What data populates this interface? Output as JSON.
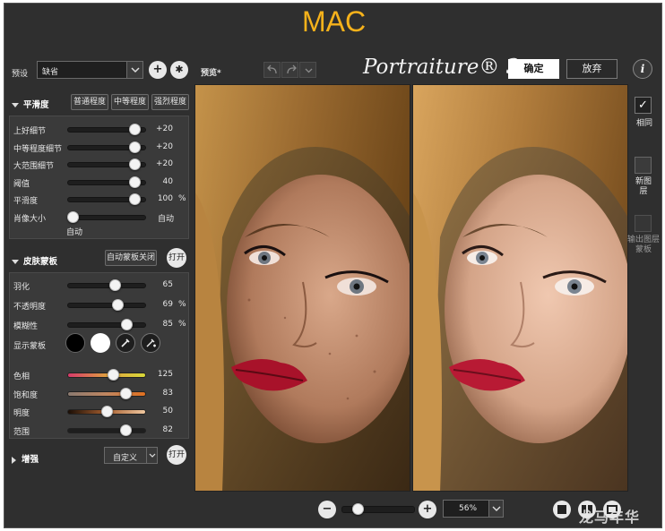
{
  "window": {
    "title": "MAC"
  },
  "toolbar": {
    "preset_label": "预设",
    "preset_value": "缺省",
    "add_icon": "plus-icon",
    "settings_icon": "gear-icon",
    "preview_label": "预览*",
    "app_title": "Portraiture® 3",
    "ok_label": "确定",
    "cancel_label": "放弃",
    "info_icon": "info-icon"
  },
  "smoothing": {
    "header": "平滑度",
    "buttons": [
      "普通程度",
      "中等程度",
      "强烈程度"
    ],
    "sliders": [
      {
        "label": "上好细节",
        "value": "+20",
        "unit": "",
        "level": 0.92
      },
      {
        "label": "中等程度细节",
        "value": "+20",
        "unit": "",
        "level": 0.92
      },
      {
        "label": "大范围细节",
        "value": "+20",
        "unit": "",
        "level": 0.92
      },
      {
        "label": "阈值",
        "value": "40",
        "unit": "",
        "level": 0.92
      },
      {
        "label": "平滑度",
        "value": "100",
        "unit": "%",
        "level": 0.92
      }
    ],
    "portrait_size": {
      "label": "肖像大小",
      "value": "自动",
      "sub_label": "自动",
      "level": 0.0
    }
  },
  "skin_mask": {
    "header": "皮肤蒙板",
    "auto_mask_label": "自动蒙板关闭",
    "open_label": "打开",
    "sliders": [
      {
        "label": "羽化",
        "value": "65",
        "unit": "",
        "level": 0.62
      },
      {
        "label": "不透明度",
        "value": "69",
        "unit": "%",
        "level": 0.66
      },
      {
        "label": "模糊性",
        "value": "85",
        "unit": "%",
        "level": 0.8
      }
    ],
    "show_mask_label": "显示蒙板",
    "color_sliders": [
      {
        "label": "色相",
        "value": "125",
        "level": 0.6,
        "gradient": [
          "#d63a6a",
          "#e0a040",
          "#d8d838"
        ]
      },
      {
        "label": "饱和度",
        "value": "83",
        "level": 0.78,
        "gradient": [
          "#8a7a70",
          "#c08660",
          "#e07020"
        ]
      },
      {
        "label": "明度",
        "value": "50",
        "level": 0.5,
        "gradient": [
          "#1a0e06",
          "#a86030",
          "#f0c8a0"
        ]
      },
      {
        "label": "范围",
        "value": "82",
        "level": 0.78,
        "gradient": [
          "#1e1e1e",
          "#1e1e1e"
        ]
      }
    ]
  },
  "enhance": {
    "header": "增强",
    "mode_value": "自定义",
    "open_label": "打开"
  },
  "right_panel": {
    "same_label": "相同",
    "new_layer_label": "新图层",
    "output_mask_label": "输出图层蒙板"
  },
  "bottom": {
    "zoom_value": "56%",
    "zoom_out_icon": "minus-icon",
    "zoom_in_icon": "plus-icon",
    "zoom_level": 0.18
  },
  "watermark": "龙马年华"
}
